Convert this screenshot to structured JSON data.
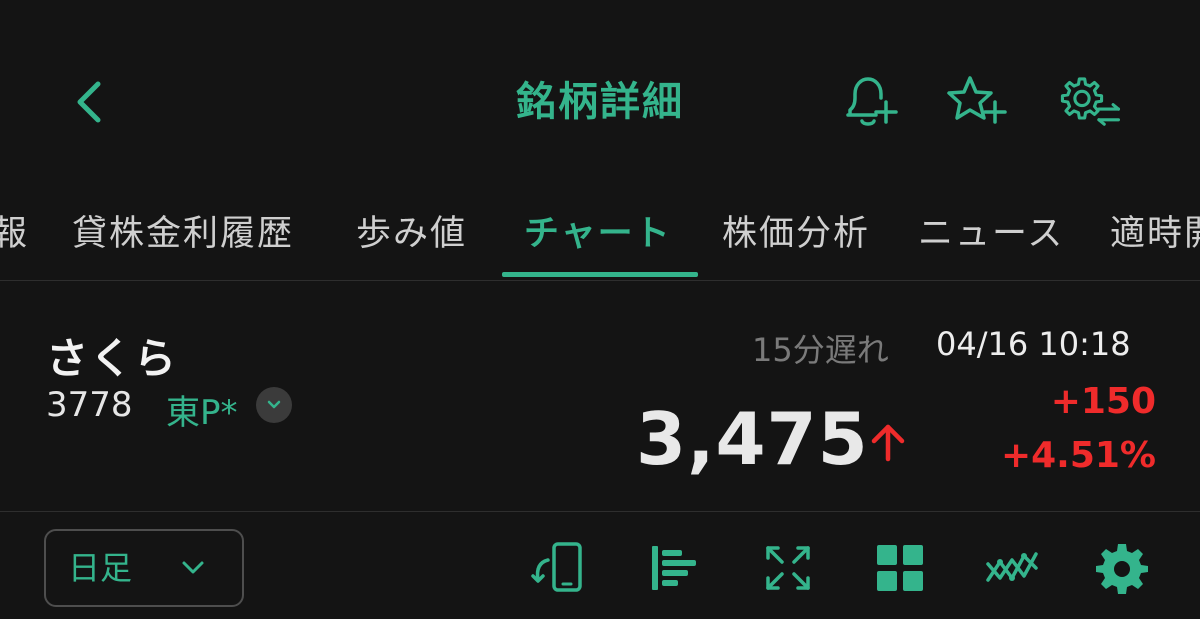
{
  "header": {
    "title": "銘柄詳細",
    "icons": [
      "back-chevron-icon",
      "bell-plus-icon",
      "star-plus-icon",
      "gear-switch-icon"
    ]
  },
  "tabs": [
    {
      "label": "報"
    },
    {
      "label": "貸株金利履歴"
    },
    {
      "label": "歩み値"
    },
    {
      "label": "チャート",
      "active": true
    },
    {
      "label": "株価分析"
    },
    {
      "label": "ニュース"
    },
    {
      "label": "適時開"
    }
  ],
  "quote": {
    "name": "さくら",
    "code": "3778",
    "market": "東P*",
    "delay": "15分遅れ",
    "timestamp": "04/16 10:18",
    "price": "3,475",
    "change": "+150",
    "change_pct": "+4.51%"
  },
  "toolbar": {
    "period": "日足",
    "tools": [
      "rotate-phone-icon",
      "align-bars-icon",
      "expand-icon",
      "grid-icon",
      "indicator-icon",
      "settings-icon"
    ]
  },
  "colors": {
    "accent": "#34b48c",
    "background": "#141414",
    "up": "#ef2b2b",
    "muted": "#7a7a7a"
  }
}
